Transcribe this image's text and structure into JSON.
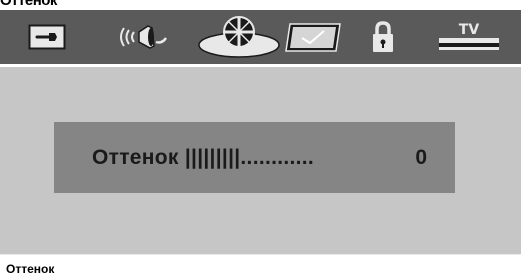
{
  "page_title": "Оттенок",
  "tabs": [
    {
      "name": "setup",
      "icon": "wrench-icon"
    },
    {
      "name": "audio",
      "icon": "speaker-icon"
    },
    {
      "name": "video",
      "icon": "disc-icon"
    },
    {
      "name": "preferences",
      "icon": "checkmark-icon"
    },
    {
      "name": "parental-lock",
      "icon": "lock-icon"
    },
    {
      "name": "tv",
      "icon": "tv-icon",
      "label": "TV"
    }
  ],
  "setting": {
    "label": "Оттенок |||||||||............",
    "value": "0"
  },
  "caption": "Оттенок",
  "colors": {
    "tabbar": "#5a5a5a",
    "screen": "#c6c6c6",
    "dialog": "#858585",
    "icon_fill": "#e8e8e8"
  }
}
